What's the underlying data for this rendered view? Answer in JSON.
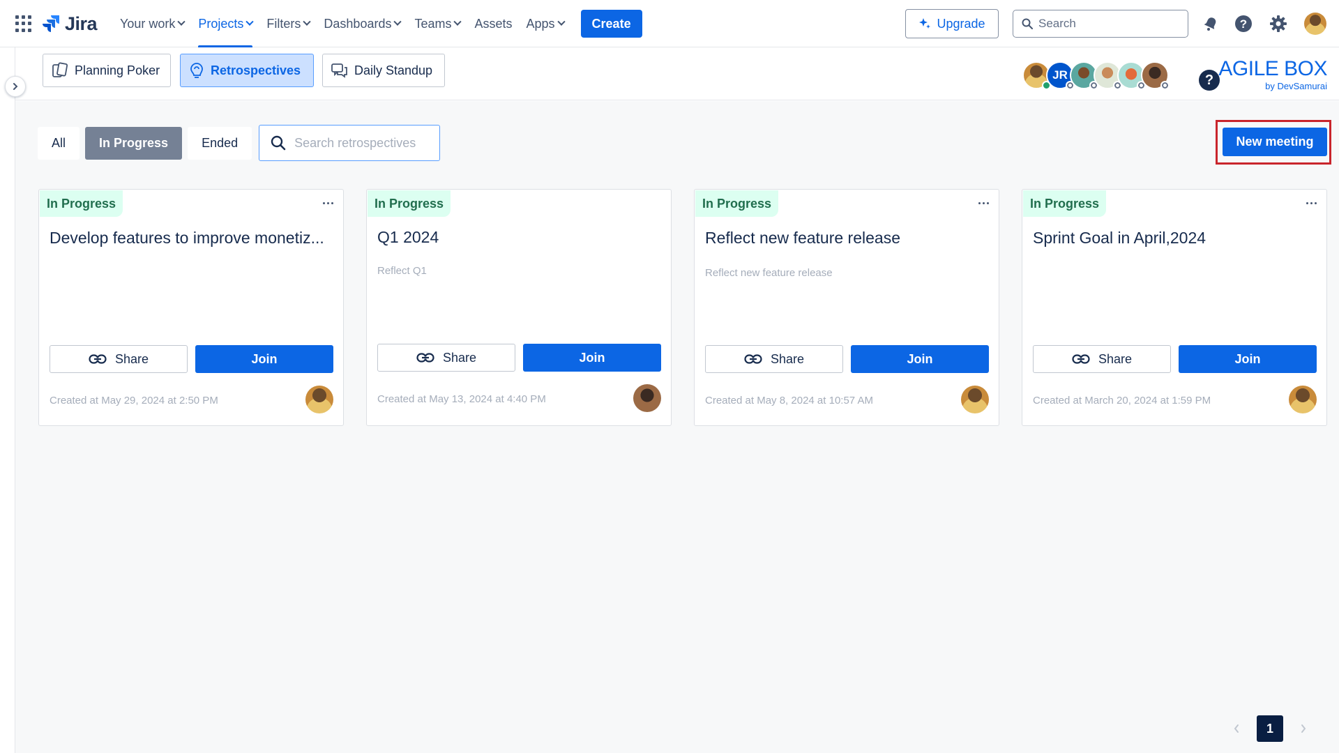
{
  "topnav": {
    "product": "Jira",
    "menu": [
      {
        "label": "Your work",
        "dropdown": true
      },
      {
        "label": "Projects",
        "dropdown": true,
        "active": true
      },
      {
        "label": "Filters",
        "dropdown": true
      },
      {
        "label": "Dashboards",
        "dropdown": true
      },
      {
        "label": "Teams",
        "dropdown": true
      },
      {
        "label": "Assets",
        "dropdown": false
      },
      {
        "label": "Apps",
        "dropdown": true
      }
    ],
    "create_label": "Create",
    "upgrade_label": "Upgrade",
    "search_placeholder": "Search"
  },
  "app": {
    "tabs": [
      {
        "label": "Planning Poker",
        "icon": "cards-icon"
      },
      {
        "label": "Retrospectives",
        "icon": "retro-icon",
        "active": true
      },
      {
        "label": "Daily Standup",
        "icon": "chat-icon"
      }
    ],
    "team_initials": "JR",
    "help_glyph": "?",
    "brand": "AGILE BOX",
    "brand_sub": "by DevSamurai"
  },
  "filters": {
    "all_label": "All",
    "in_progress_label": "In Progress",
    "ended_label": "Ended",
    "search_placeholder": "Search retrospectives",
    "active": "In Progress"
  },
  "new_meeting_label": "New meeting",
  "cards": [
    {
      "status": "In Progress",
      "title": "Develop features to improve monetiz...",
      "description": "",
      "share_label": "Share",
      "join_label": "Join",
      "created": "Created at May 29, 2024 at 2:50 PM",
      "avatar": "woman-avatar"
    },
    {
      "status": "In Progress",
      "title": "Q1 2024",
      "description": "Reflect Q1",
      "share_label": "Share",
      "join_label": "Join",
      "created": "Created at May 13, 2024 at 4:40 PM",
      "avatar": "man-avatar"
    },
    {
      "status": "In Progress",
      "title": "Reflect new feature release",
      "description": "Reflect new feature release",
      "share_label": "Share",
      "join_label": "Join",
      "created": "Created at May 8, 2024 at 10:57 AM",
      "avatar": "woman-avatar"
    },
    {
      "status": "In Progress",
      "title": "Sprint Goal in April,2024",
      "description": "",
      "share_label": "Share",
      "join_label": "Join",
      "created": "Created at March 20, 2024 at 1:59 PM",
      "avatar": "woman-avatar"
    }
  ],
  "pagination": {
    "current_page": "1"
  },
  "colors": {
    "accent": "#0c66e4",
    "status_bg": "#dcfff1",
    "status_text": "#216e4e",
    "highlight": "#c9252c"
  }
}
